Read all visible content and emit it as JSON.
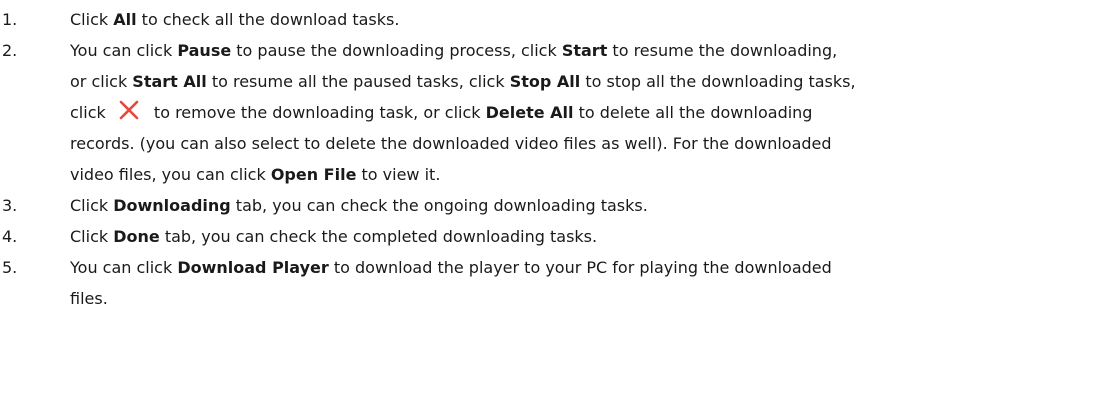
{
  "steps": [
    {
      "number": "1.",
      "lines": [
        [
          {
            "t": "Click "
          },
          {
            "t": "All",
            "b": true
          },
          {
            "t": " to check all the download tasks."
          }
        ]
      ]
    },
    {
      "number": "2.",
      "lines": [
        [
          {
            "t": "You can click "
          },
          {
            "t": "Pause",
            "b": true
          },
          {
            "t": " to pause the downloading process, click "
          },
          {
            "t": "Start",
            "b": true
          },
          {
            "t": " to resume the downloading,"
          }
        ],
        [
          {
            "t": "or click "
          },
          {
            "t": "Start All",
            "b": true
          },
          {
            "t": " to resume all the paused tasks, click "
          },
          {
            "t": "Stop All",
            "b": true
          },
          {
            "t": " to stop all the downloading tasks,"
          }
        ],
        [
          {
            "t": "click "
          },
          {
            "icon": "close-icon"
          },
          {
            "t": " to remove the downloading task, or click "
          },
          {
            "t": "Delete All",
            "b": true
          },
          {
            "t": " to delete all the downloading"
          }
        ],
        [
          {
            "t": "records. (you can also select to delete the downloaded video files as well). For the downloaded"
          }
        ],
        [
          {
            "t": "video files, you can click "
          },
          {
            "t": "Open File",
            "b": true
          },
          {
            "t": " to view it."
          }
        ]
      ]
    },
    {
      "number": "3.",
      "lines": [
        [
          {
            "t": "Click "
          },
          {
            "t": "Downloading",
            "b": true
          },
          {
            "t": " tab, you can check the ongoing downloading tasks."
          }
        ]
      ]
    },
    {
      "number": "4.",
      "lines": [
        [
          {
            "t": "Click "
          },
          {
            "t": "Done",
            "b": true
          },
          {
            "t": " tab, you can check the completed downloading tasks."
          }
        ]
      ]
    },
    {
      "number": "5.",
      "lines": [
        [
          {
            "t": "You can click "
          },
          {
            "t": "Download Player",
            "b": true
          },
          {
            "t": " to download the player to your PC for playing the downloaded"
          }
        ],
        [
          {
            "t": "files."
          }
        ]
      ]
    }
  ],
  "colors": {
    "text": "#1a1a1a",
    "icon": "#e8473c"
  }
}
